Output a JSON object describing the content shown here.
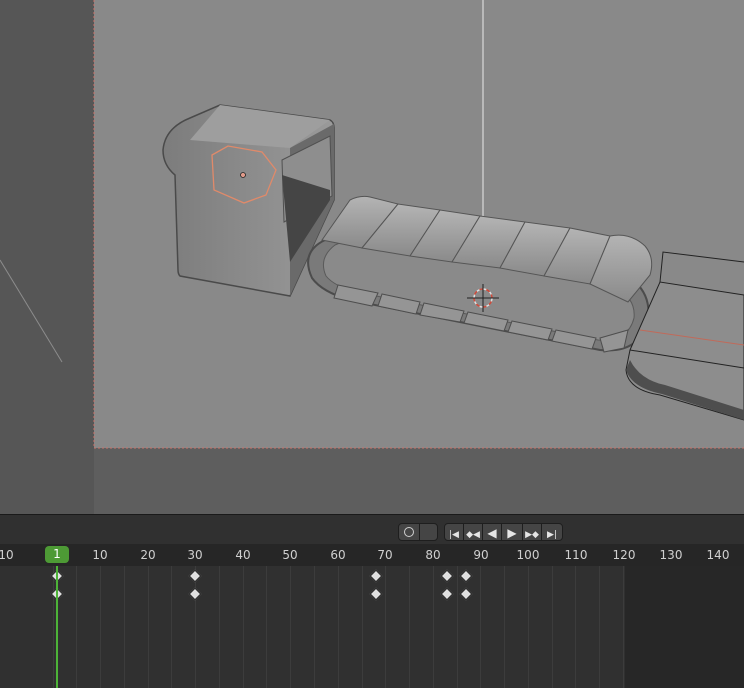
{
  "viewport": {
    "scene": "3D conveyor belt model with track segments, box housing and 3D cursor"
  },
  "timeline": {
    "controls": {
      "record_icon": "record-circle-icon",
      "buttons": [
        {
          "name": "jump-to-start-button",
          "glyph": "|◀"
        },
        {
          "name": "prev-keyframe-button",
          "glyph": "◆◀"
        },
        {
          "name": "play-reverse-button",
          "glyph": "◀"
        },
        {
          "name": "play-button",
          "glyph": "▶"
        },
        {
          "name": "next-keyframe-button",
          "glyph": "▶◆"
        },
        {
          "name": "jump-to-end-button",
          "glyph": "▶|"
        }
      ]
    },
    "ruler_ticks": [
      "10",
      "1",
      "10",
      "20",
      "30",
      "40",
      "50",
      "60",
      "70",
      "80",
      "90",
      "100",
      "110",
      "120",
      "130",
      "140"
    ],
    "current_frame": "1",
    "keyframe_frames": [
      1,
      30,
      68,
      83,
      87
    ],
    "colors": {
      "playhead": "#4db338",
      "keyframe": "#e0e0e0"
    }
  }
}
